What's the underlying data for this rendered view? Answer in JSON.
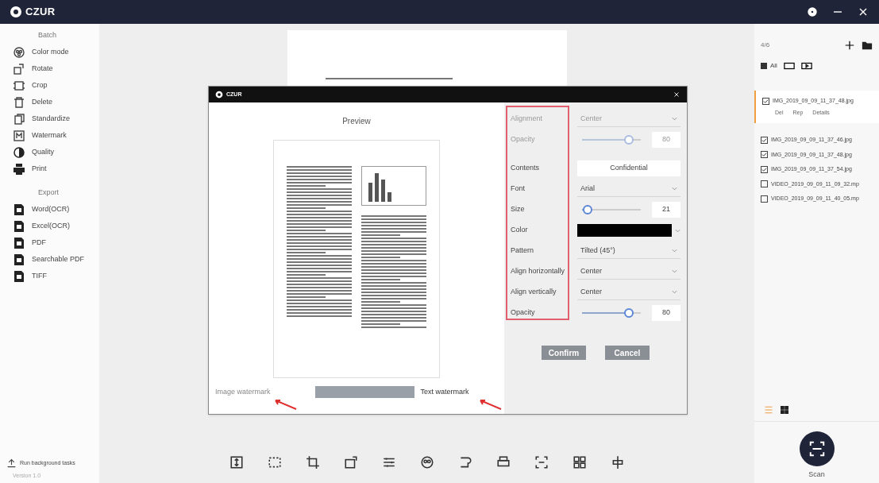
{
  "app": {
    "logo": "CZUR"
  },
  "sidebar": {
    "sections": [
      {
        "title": "Batch",
        "items": [
          {
            "label": "Color mode"
          },
          {
            "label": "Rotate"
          },
          {
            "label": "Crop"
          },
          {
            "label": "Delete"
          },
          {
            "label": "Standardize"
          },
          {
            "label": "Watermark"
          },
          {
            "label": "Quality"
          },
          {
            "label": "Print"
          }
        ]
      },
      {
        "title": "Export",
        "items": [
          {
            "label": "Word(OCR)"
          },
          {
            "label": "Excel(OCR)"
          },
          {
            "label": "PDF"
          },
          {
            "label": "Searchable PDF"
          },
          {
            "label": "TIFF"
          }
        ]
      }
    ],
    "footer": "Run background tasks",
    "version": "Version 1.0"
  },
  "dialog": {
    "logo": "CZUR",
    "preview_title": "Preview",
    "tabs": [
      {
        "label": "Image watermark",
        "selected": false
      },
      {
        "label": "Text watermark",
        "selected": true
      }
    ],
    "settings": [
      {
        "kind": "select",
        "label": "Alignment",
        "value": "Center",
        "disabled": true
      },
      {
        "kind": "slider",
        "label": "Opacity",
        "level": 0.8,
        "value": "80",
        "disabled": true
      },
      {
        "kind": "text",
        "label": "Contents",
        "value": "Confidential",
        "disabled": false
      },
      {
        "kind": "select",
        "label": "Font",
        "value": "Arial",
        "disabled": false
      },
      {
        "kind": "slider",
        "label": "Size",
        "level": 0.1,
        "value": "21",
        "disabled": false
      },
      {
        "kind": "color",
        "label": "Color",
        "color": "#000000",
        "disabled": false
      },
      {
        "kind": "select",
        "label": "Pattern",
        "value": "Tilted (45°)",
        "disabled": false
      },
      {
        "kind": "select",
        "label": "Align horizontally",
        "value": "Center",
        "disabled": false
      },
      {
        "kind": "select",
        "label": "Align vertically",
        "value": "Center",
        "disabled": false
      },
      {
        "kind": "slider",
        "label": "Opacity",
        "level": 0.8,
        "value": "80",
        "disabled": false
      }
    ],
    "buttons": [
      "Confirm",
      "Cancel"
    ]
  },
  "files": {
    "count": "4/6",
    "all": {
      "label": "All",
      "checked": true
    },
    "items": [
      {
        "name": "IMG_2019_09_09_11_37_48.jpg",
        "checked": true,
        "selected": true,
        "actions": [
          "Del",
          "Rep",
          "Details"
        ]
      },
      {
        "name": "IMG_2019_09_09_11_37_46.jpg",
        "checked": true,
        "selected": false
      },
      {
        "name": "IMG_2019_09_09_11_37_48.jpg",
        "checked": true,
        "selected": false
      },
      {
        "name": "IMG_2019_09_09_11_37_54.jpg",
        "checked": true,
        "selected": false
      },
      {
        "name": "VIDEO_2019_09_09_11_09_32.mp",
        "checked": false,
        "selected": false
      },
      {
        "name": "VIDEO_2019_09_09_11_40_05.mp",
        "checked": false,
        "selected": false
      }
    ],
    "view": [
      {
        "selected": true
      },
      {
        "selected": false
      }
    ],
    "scan": "Scan"
  }
}
